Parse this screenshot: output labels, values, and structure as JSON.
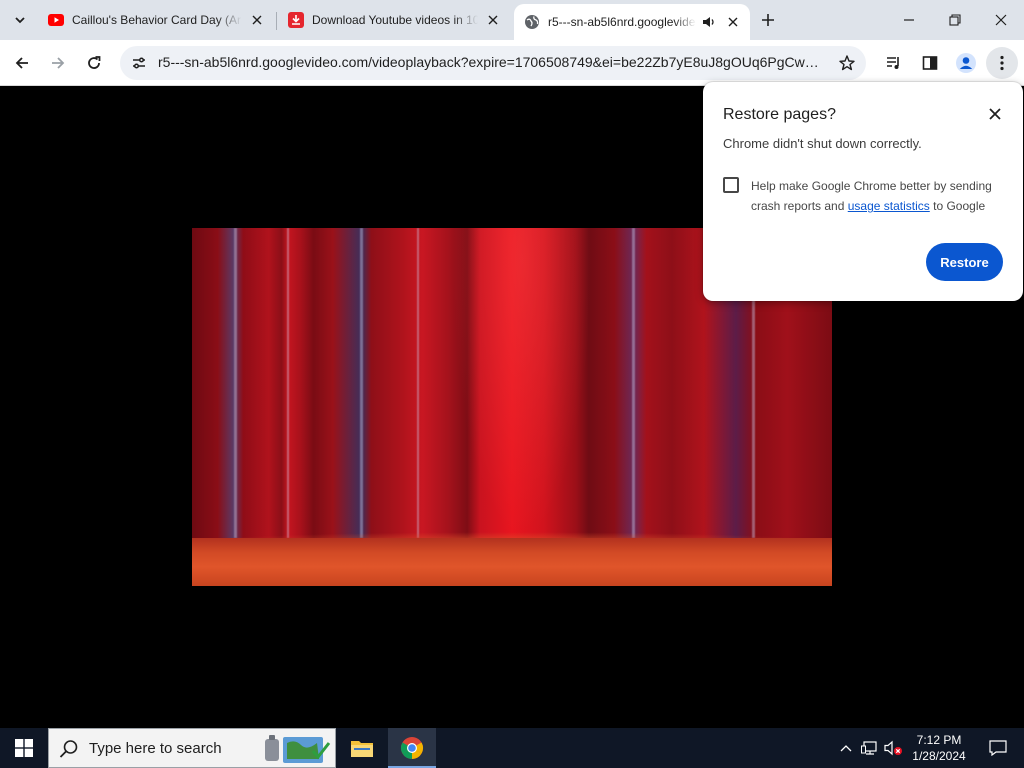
{
  "browser": {
    "tabs": [
      {
        "title": "Caillou's Behavior Card Day (Ar",
        "favicon": "youtube-icon"
      },
      {
        "title": "Download Youtube videos in 10",
        "favicon": "download-icon"
      },
      {
        "title": "r5---sn-ab5l6nrd.googlevideo",
        "favicon": "globe-icon",
        "active": true,
        "audio": true
      }
    ],
    "url": "r5---sn-ab5l6nrd.googlevideo.com/videoplayback?expire=1706508749&ei=be22Zb7yE8uJ8gOUq6PgCw&i..."
  },
  "popup": {
    "title": "Restore pages?",
    "message": "Chrome didn't shut down correctly.",
    "checkbox_text_before": "Help make Google Chrome better by sending crash reports and",
    "checkbox_link": "usage statistics",
    "checkbox_text_after": "to Google",
    "checked": false,
    "restore_label": "Restore"
  },
  "taskbar": {
    "search_placeholder": "Type here to search",
    "time": "7:12 PM",
    "date": "1/28/2024"
  },
  "colors": {
    "accent": "#0b57d0",
    "tabstrip": "#dee3ea",
    "taskbar": "#0f1726"
  }
}
